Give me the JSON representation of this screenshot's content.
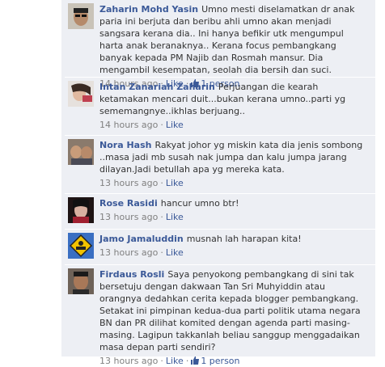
{
  "comments": [
    {
      "author": "Zaharin Mohd Yasin",
      "text": "Umno mesti diselamatkan dr anak paria ini berjuta dan beribu ahli umno akan menjadi sangsara kerana dia.. Ini hanya befikir utk mengumpul harta anak beranaknya.. Kerana focus pembangkang banyak kepada PM Najib dan Rosmah mansur. Dia mengambil kesempatan, seolah dia bersih dan suci.",
      "time": "14 hours ago",
      "like_label": "Like",
      "likes": "1 person",
      "avatar_icon": "profile-photo"
    },
    {
      "author": "Intan Zanariah Zaharin",
      "text": "Perjuangan die kearah ketamakan mencari duit...bukan kerana umno..parti yg sememangnye..ikhlas berjuang..",
      "time": "14 hours ago",
      "like_label": "Like",
      "likes": "",
      "avatar_icon": "profile-photo"
    },
    {
      "author": "Nora Hash",
      "text": "Rakyat johor yg miskin kata dia jenis sombong ..masa jadi mb susah nak jumpa dan kalu jumpa jarang dilayan.Jadi betullah apa yg mereka kata.",
      "time": "13 hours ago",
      "like_label": "Like",
      "likes": "",
      "avatar_icon": "profile-photo"
    },
    {
      "author": "Rose Rasidi",
      "text": "hancur umno btr!",
      "time": "13 hours ago",
      "like_label": "Like",
      "likes": "",
      "avatar_icon": "profile-photo"
    },
    {
      "author": "Jamo Jamaluddin",
      "text": "musnah lah harapan kita!",
      "time": "13 hours ago",
      "like_label": "Like",
      "likes": "",
      "avatar_icon": "warning-sign-photo"
    },
    {
      "author": "Firdaus Rosli",
      "text": "Saya penyokong pembangkang di sini tak bersetuju dengan dakwaan Tan Sri Muhyiddin atau orangnya dedahkan cerita kepada blogger pembangkang. Setakat ini pimpinan kedua-dua parti politik utama negara BN dan PR dilihat komited dengan agenda parti masing-masing. Lagipun takkanlah beliau sanggup menggadaikan masa depan parti sendiri?",
      "time": "13 hours ago",
      "like_label": "Like",
      "likes": "1 person",
      "avatar_icon": "profile-photo"
    }
  ],
  "colors": {
    "background": "#edeff4",
    "author_link": "#3b5998",
    "meta_text": "#808080",
    "body_text": "#333333"
  }
}
